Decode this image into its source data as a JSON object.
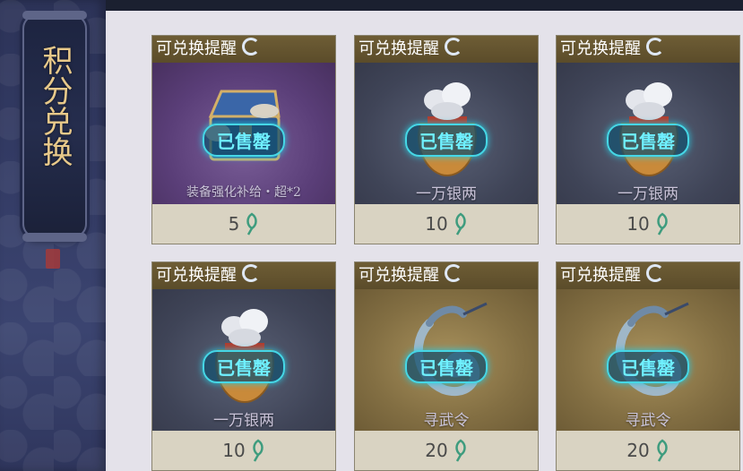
{
  "sidebar": {
    "title": "积分兑换"
  },
  "cards": [
    {
      "tag": "可兑换提醒",
      "badge": "已售罄",
      "name": "装备强化补给・超*2",
      "price": "5",
      "theme": "purple",
      "art": "chest-icon"
    },
    {
      "tag": "可兑换提醒",
      "badge": "已售罄",
      "name": "一万银两",
      "price": "10",
      "theme": "slate",
      "art": "silver-bag-icon"
    },
    {
      "tag": "可兑换提醒",
      "badge": "已售罄",
      "name": "一万银两",
      "price": "10",
      "theme": "slate",
      "art": "silver-bag-icon"
    },
    {
      "tag": "可兑换提醒",
      "badge": "已售罄",
      "name": "一万银两",
      "price": "10",
      "theme": "slate",
      "art": "silver-bag-icon"
    },
    {
      "tag": "可兑换提醒",
      "badge": "已售罄",
      "name": "寻武令",
      "price": "20",
      "theme": "gold",
      "art": "jade-token-icon"
    },
    {
      "tag": "可兑换提醒",
      "badge": "已售罄",
      "name": "寻武令",
      "price": "20",
      "theme": "gold",
      "art": "jade-token-icon"
    }
  ],
  "currency_icon": "jade-currency-icon",
  "colors": {
    "badge": "#6ff0ff",
    "header": "#5b4c2a",
    "sidebar": "#343c66"
  }
}
